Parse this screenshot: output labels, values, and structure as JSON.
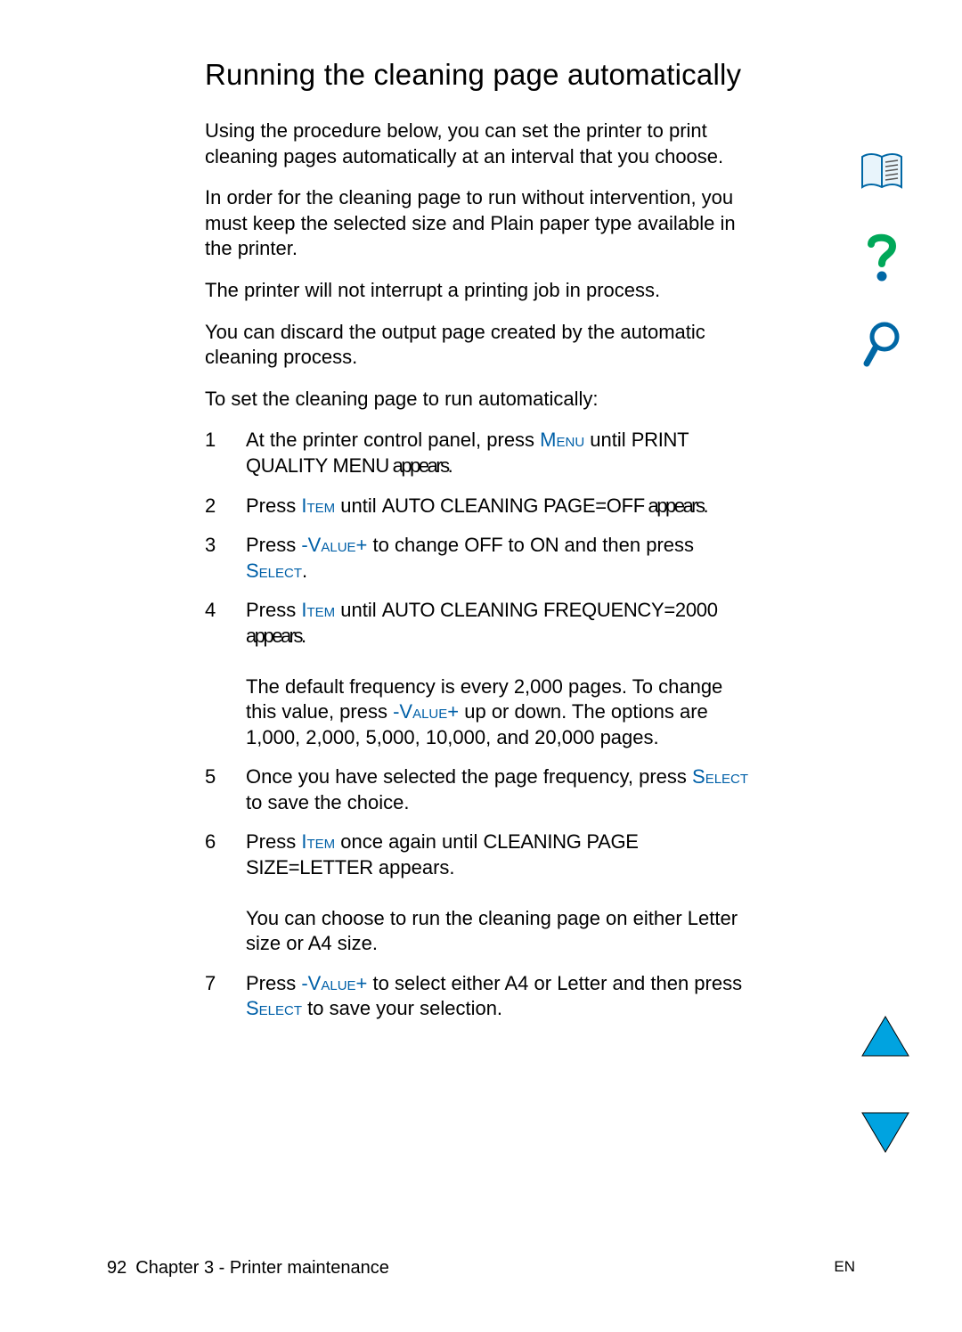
{
  "title": "Running the cleaning page automatically",
  "paragraphs": {
    "p1": "Using the procedure below, you can set the printer to print cleaning pages automatically at an interval that you choose.",
    "p2": "In order for the cleaning page to run without intervention, you must keep the selected size and Plain paper type available in the printer.",
    "p3": "The printer will not interrupt a printing job in process.",
    "p4": "You can discard the output page created by the automatic cleaning process.",
    "p5": "To set the cleaning page to run automatically:"
  },
  "steps": {
    "s1": {
      "num": "1",
      "pre": "At the printer control panel, press ",
      "key1": "Menu",
      "mid": " until ",
      "disp": "PRINT QUALITY MENU",
      "post": " appears."
    },
    "s2": {
      "num": "2",
      "pre": "Press ",
      "key1": "Item",
      "mid": " until ",
      "disp": "AUTO CLEANING PAGE=OFF",
      "post": " appears."
    },
    "s3": {
      "num": "3",
      "pre": "Press ",
      "key1": "-Value+",
      "mid": " to change ",
      "d1": "OFF",
      "mid2": " to ",
      "d2": "ON",
      "mid3": " and then press ",
      "key2": "Select",
      "post": "."
    },
    "s4": {
      "num": "4",
      "pre": "Press ",
      "key1": "Item",
      "mid": " until ",
      "disp": "AUTO CLEANING FREQUENCY=2000",
      "post": " appears.",
      "sub": {
        "t1": "The default frequency is every 2,000 pages. To change this value, press ",
        "key": "-Value+",
        "t2": " up or down. The options are 1,000, 2,000, 5,000, 10,000, and 20,000 pages."
      }
    },
    "s5": {
      "num": "5",
      "pre": "Once you have selected the page frequency, press ",
      "key1": "Select",
      "post": " to save the choice."
    },
    "s6": {
      "num": "6",
      "pre": "Press ",
      "key1": "Item",
      "mid": " once again until ",
      "disp": "CLEANING PAGE SIZE=LETTER",
      "post": " appears.",
      "sub": {
        "t1": "You can choose to run the cleaning page on either Letter size or A4 size."
      }
    },
    "s7": {
      "num": "7",
      "pre": "Press ",
      "key1": "-Value+",
      "mid": " to select either A4 or Letter and then press ",
      "key2": "Select",
      "post": " to save your selection."
    }
  },
  "footer": {
    "page": "92",
    "chapter": "Chapter 3 - Printer maintenance",
    "lang": "EN"
  }
}
